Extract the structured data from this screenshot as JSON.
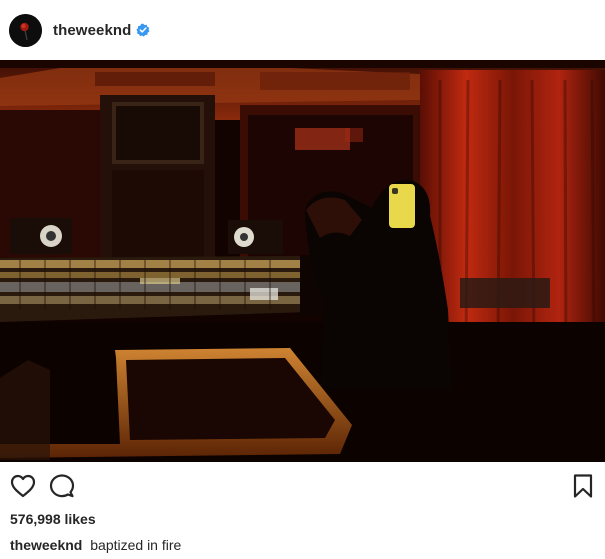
{
  "post": {
    "username": "theweeknd",
    "verified": true,
    "likes_text": "576,998 likes",
    "caption_user": "theweeknd",
    "caption_text": "baptized in fire"
  },
  "icons": {
    "avatar": "rose-avatar",
    "verified": "verified-badge-icon",
    "like": "heart-icon",
    "comment": "comment-icon",
    "save": "bookmark-icon"
  },
  "colors": {
    "verified_blue": "#3897f0",
    "text": "#262626",
    "photo_red": "#c8290e",
    "photo_orange": "#e87d2a"
  }
}
